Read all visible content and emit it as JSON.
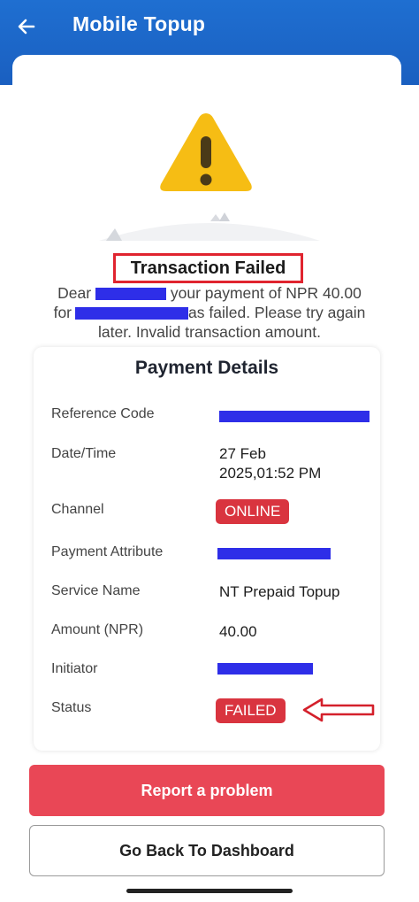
{
  "app_bar": {
    "title": "Mobile Topup",
    "back_icon": "arrow-left-icon",
    "color": "#1f6fd1"
  },
  "result": {
    "icon": "warning-icon",
    "headline": "Transaction Failed",
    "message": {
      "line1_prefix": "Dear",
      "line1_suffix": "your payment of NPR 40.00",
      "line2_prefix": "for",
      "line2_suffix": "as failed. Please try again",
      "line3": "later. Invalid transaction amount."
    }
  },
  "details": {
    "title": "Payment Details",
    "reference_code_label": "Reference Code",
    "datetime_label": "Date/Time",
    "datetime_value_line1": "27 Feb",
    "datetime_value_line2": "2025,01:52 PM",
    "channel_label": "Channel",
    "channel_value": "ONLINE",
    "payment_attribute_label": "Payment Attribute",
    "service_name_label": "Service Name",
    "service_name_value": "NT Prepaid Topup",
    "amount_label": "Amount (NPR)",
    "amount_value": "40.00",
    "initiator_label": "Initiator",
    "status_label": "Status",
    "status_value": "FAILED"
  },
  "actions": {
    "report_label": "Report a problem",
    "dashboard_label": "Go Back To Dashboard"
  },
  "colors": {
    "error_red": "#e0242f",
    "badge_red": "#d9343f",
    "button_red": "#e94756",
    "warning_yellow": "#f6bd14",
    "redaction_blue": "#2e2ee8"
  }
}
